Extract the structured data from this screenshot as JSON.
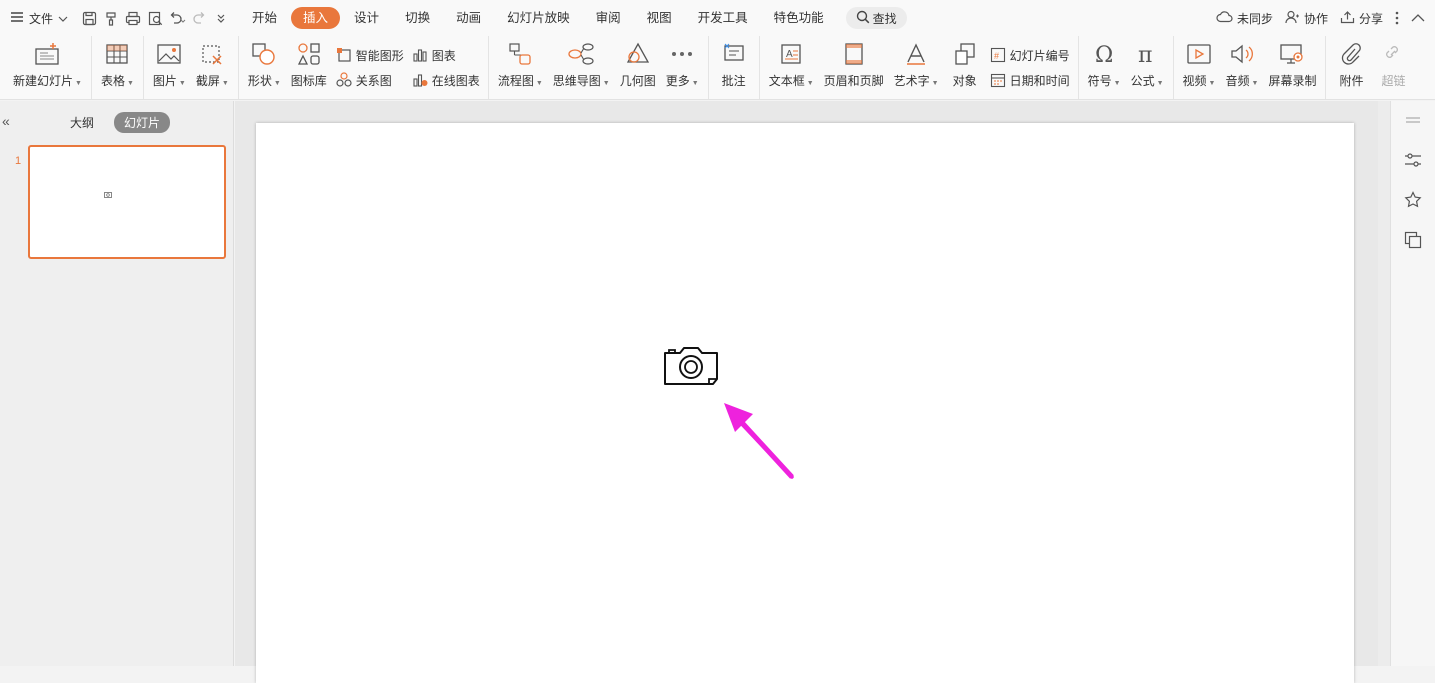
{
  "menubar": {
    "file_label": "文件",
    "tabs": [
      {
        "label": "开始"
      },
      {
        "label": "插入"
      },
      {
        "label": "设计"
      },
      {
        "label": "切换"
      },
      {
        "label": "动画"
      },
      {
        "label": "幻灯片放映"
      },
      {
        "label": "审阅"
      },
      {
        "label": "视图"
      },
      {
        "label": "开发工具"
      },
      {
        "label": "特色功能"
      }
    ],
    "search_label": "查找",
    "sync_label": "未同步",
    "collab_label": "协作",
    "share_label": "分享"
  },
  "ribbon": {
    "new_slide": "新建幻灯片",
    "table": "表格",
    "picture": "图片",
    "screenshot": "截屏",
    "shape": "形状",
    "icon_lib": "图标库",
    "smart_shape": "智能图形",
    "chart": "图表",
    "relation": "关系图",
    "online_chart": "在线图表",
    "flowchart": "流程图",
    "mindmap": "思维导图",
    "geometry": "几何图",
    "more": "更多",
    "comment": "批注",
    "textbox": "文本框",
    "header_footer": "页眉和页脚",
    "wordart": "艺术字",
    "object": "对象",
    "slide_number": "幻灯片编号",
    "date_time": "日期和时间",
    "symbol": "符号",
    "formula": "公式",
    "video": "视频",
    "audio": "音频",
    "screen_record": "屏幕录制",
    "attachment": "附件",
    "hyperlink": "超链"
  },
  "leftpane": {
    "outline_tab": "大纲",
    "slides_tab": "幻灯片",
    "slide_number": "1"
  },
  "colors": {
    "accent": "#e9773c",
    "arrow": "#ee22dd"
  }
}
